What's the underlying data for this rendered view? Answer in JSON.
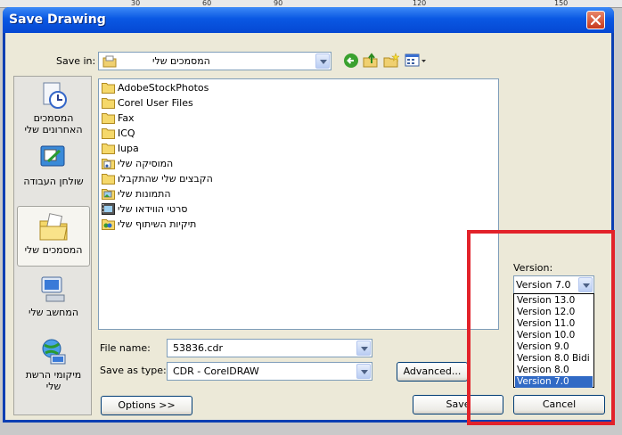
{
  "ruler": {
    "ticks": [
      "30",
      "60",
      "90",
      "120",
      "150"
    ]
  },
  "window": {
    "title": "Save Drawing"
  },
  "save_in": {
    "label": "Save in:",
    "value": "המסמכים שלי"
  },
  "places": [
    {
      "label": "המסמכים האחרונים שלי",
      "icon": "recent-documents-icon"
    },
    {
      "label": "שולחן העבודה",
      "icon": "desktop-icon"
    },
    {
      "label": "המסמכים שלי",
      "icon": "my-documents-icon",
      "selected": true
    },
    {
      "label": "המחשב שלי",
      "icon": "my-computer-icon"
    },
    {
      "label": "מיקומי הרשת שלי",
      "icon": "network-places-icon"
    }
  ],
  "files": [
    {
      "name": "AdobeStockPhotos",
      "icon": "folder-icon"
    },
    {
      "name": "Corel User Files",
      "icon": "folder-icon"
    },
    {
      "name": "Fax",
      "icon": "folder-icon"
    },
    {
      "name": "ICQ",
      "icon": "folder-icon"
    },
    {
      "name": "lupa",
      "icon": "folder-icon"
    },
    {
      "name": "המוסיקה שלי",
      "icon": "music-folder-icon"
    },
    {
      "name": "הקבצים שלי שהתקבלו",
      "icon": "folder-icon"
    },
    {
      "name": "התמונות שלי",
      "icon": "pictures-folder-icon"
    },
    {
      "name": "סרטי הווידאו שלי",
      "icon": "video-folder-icon"
    },
    {
      "name": "תיקיות השיתוף שלי",
      "icon": "shared-folder-icon"
    }
  ],
  "file_name": {
    "label": "File name:",
    "value": "53836.cdr"
  },
  "save_as_type": {
    "label": "Save as type:",
    "value": "CDR - CorelDRAW"
  },
  "version": {
    "label": "Version:",
    "value": "Version 7.0",
    "options": [
      "Version 13.0",
      "Version 12.0",
      "Version 11.0",
      "Version 10.0",
      "Version 9.0",
      "Version 8.0 Bidi",
      "Version 8.0",
      "Version 7.0"
    ],
    "highlighted": "Version 7.0"
  },
  "buttons": {
    "advanced": "Advanced...",
    "options": "Options >>",
    "save": "Save",
    "cancel": "Cancel"
  },
  "colors": {
    "title_bar": "#0a58e3",
    "dialog_bg": "#ece9d8",
    "selection": "#316ac5",
    "highlight_box": "#e2222a"
  }
}
